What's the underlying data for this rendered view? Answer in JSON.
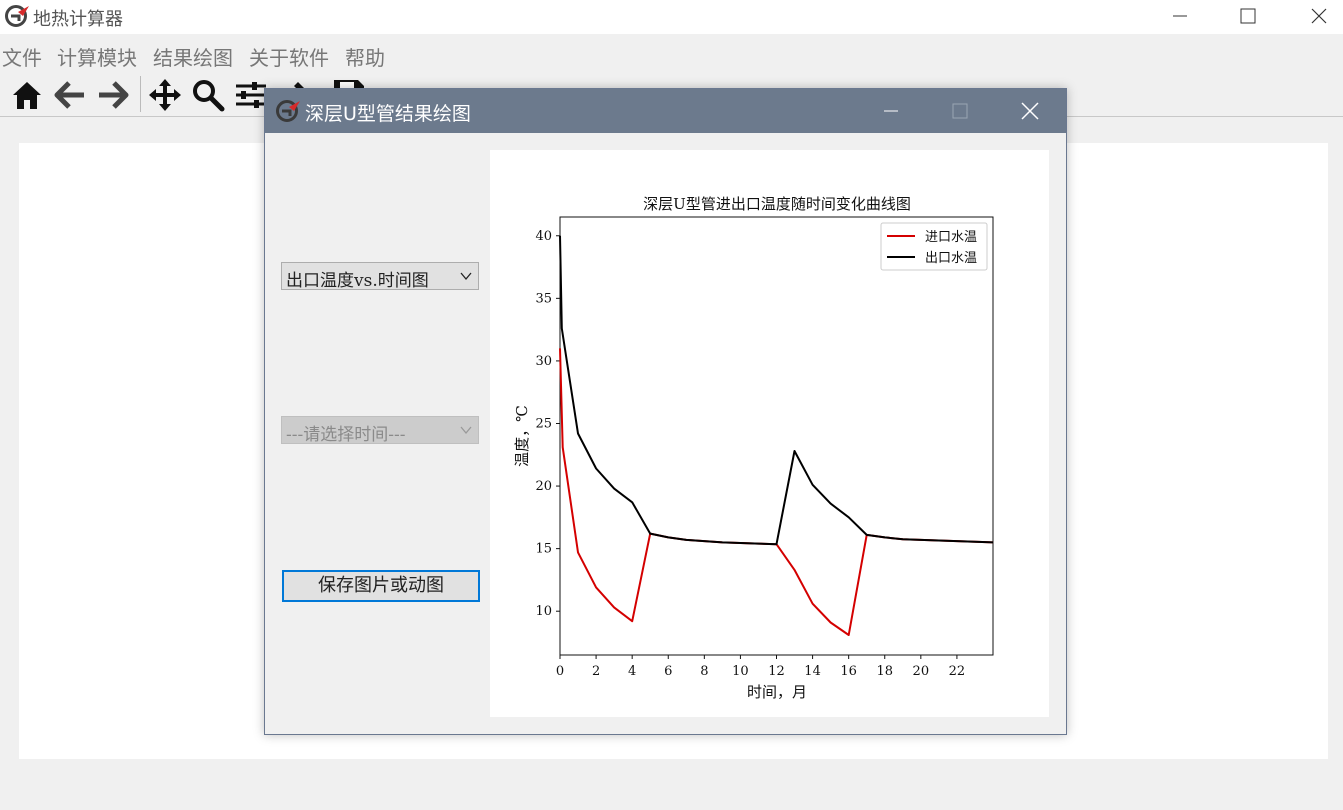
{
  "app": {
    "title": "地热计算器",
    "menu": [
      "文件",
      "计算模块",
      "结果绘图",
      "关于软件",
      "帮助"
    ],
    "toolbar_icons": [
      "home-icon",
      "back-arrow-icon",
      "forward-arrow-icon",
      "pan-icon",
      "zoom-icon",
      "configure-subplots-icon",
      "edit-icon",
      "save-icon"
    ]
  },
  "dialog": {
    "title": "深层U型管结果绘图",
    "plot_type_select": {
      "value": "出口温度vs.时间图"
    },
    "time_select": {
      "value": "---请选择时间---"
    },
    "save_button": "保存图片或动图"
  },
  "colors": {
    "dialog_titlebar": "#6c7a8d",
    "inlet_series": "#d40000",
    "outlet_series": "#000000",
    "focus_border": "#0078d7"
  },
  "chart_data": {
    "type": "line",
    "title": "深层U型管进出口温度随时间变化曲线图",
    "xlabel": "时间，月",
    "ylabel": "温度，℃",
    "xlim": [
      0,
      24
    ],
    "ylim": [
      6.5,
      41.5
    ],
    "xticks": [
      0,
      2,
      4,
      6,
      8,
      10,
      12,
      14,
      16,
      18,
      20,
      22
    ],
    "yticks": [
      10,
      15,
      20,
      25,
      30,
      35,
      40
    ],
    "grid": false,
    "legend_position": "top-right",
    "series": [
      {
        "name": "进口水温",
        "color": "#d40000",
        "x": [
          0,
          0.15,
          1,
          2,
          3,
          4,
          5,
          6,
          7,
          8,
          9,
          10,
          11,
          12,
          13,
          14,
          15,
          16,
          17,
          18,
          19,
          20,
          21,
          22,
          23,
          24
        ],
        "y": [
          31,
          23.1,
          14.7,
          11.9,
          10.3,
          9.2,
          16.2,
          15.9,
          15.7,
          15.6,
          15.5,
          15.45,
          15.4,
          15.35,
          13.3,
          10.6,
          9.1,
          8.1,
          16.1,
          15.9,
          15.75,
          15.7,
          15.65,
          15.6,
          15.55,
          15.5
        ]
      },
      {
        "name": "出口水温",
        "color": "#000000",
        "x": [
          0,
          0.1,
          1,
          2,
          3,
          4,
          5,
          6,
          7,
          8,
          9,
          10,
          11,
          12,
          13,
          14,
          15,
          16,
          17,
          18,
          19,
          20,
          21,
          22,
          23,
          24
        ],
        "y": [
          40,
          32.6,
          24.2,
          21.4,
          19.8,
          18.7,
          16.2,
          15.9,
          15.7,
          15.6,
          15.5,
          15.45,
          15.4,
          15.35,
          22.8,
          20.1,
          18.6,
          17.5,
          16.1,
          15.9,
          15.75,
          15.7,
          15.65,
          15.6,
          15.55,
          15.5
        ]
      }
    ]
  }
}
